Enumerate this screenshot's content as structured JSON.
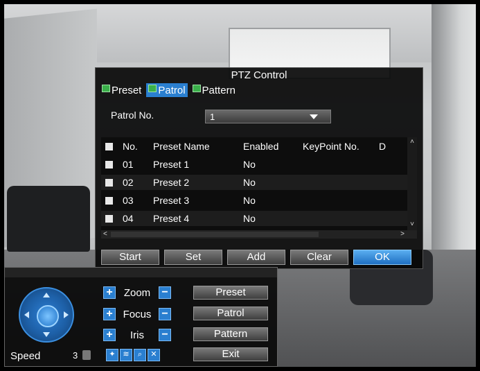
{
  "dialog": {
    "title": "PTZ Control",
    "tabs": [
      {
        "label": "Preset",
        "active": false
      },
      {
        "label": "Patrol",
        "active": true
      },
      {
        "label": "Pattern",
        "active": false
      }
    ],
    "patrol_no_label": "Patrol No.",
    "patrol_no_value": "1",
    "table": {
      "headers": [
        "No.",
        "Preset Name",
        "Enabled",
        "KeyPoint No.",
        "D"
      ],
      "rows": [
        {
          "no": "01",
          "name": "Preset 1",
          "enabled": "No"
        },
        {
          "no": "02",
          "name": "Preset 2",
          "enabled": "No"
        },
        {
          "no": "03",
          "name": "Preset 3",
          "enabled": "No"
        },
        {
          "no": "04",
          "name": "Preset 4",
          "enabled": "No"
        }
      ]
    },
    "buttons": {
      "start": "Start",
      "set": "Set",
      "add": "Add",
      "clear": "Clear",
      "ok": "OK"
    }
  },
  "ptz_panel": {
    "zoom": "Zoom",
    "focus": "Focus",
    "iris": "Iris",
    "plus": "+",
    "minus": "−",
    "buttons": {
      "preset": "Preset",
      "patrol": "Patrol",
      "pattern": "Pattern",
      "exit": "Exit"
    },
    "speed_label": "Speed",
    "speed_value": "3"
  },
  "colors": {
    "accent": "#2a7fd0",
    "dialog_bg": "#080808"
  }
}
